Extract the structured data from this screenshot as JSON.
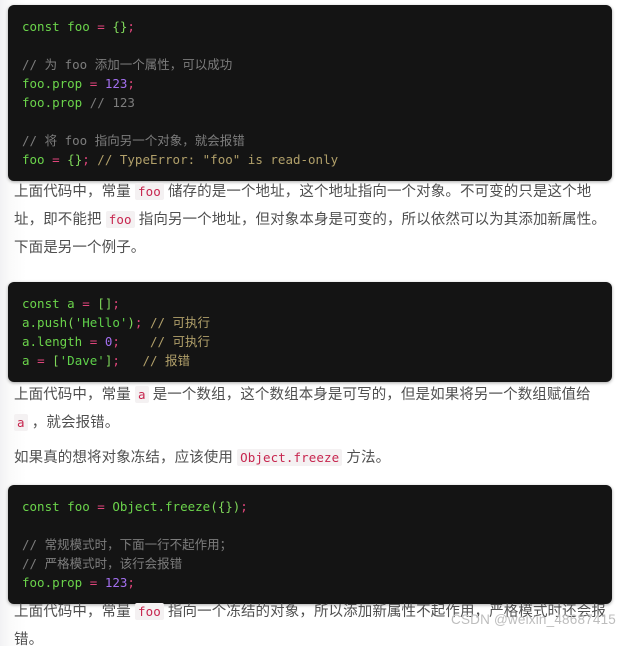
{
  "page": {
    "background_color": "#ffffff",
    "text_color": "#4f4f4f",
    "inline_code_color": "#c7254e",
    "code_block_background": "#141414"
  },
  "code_blocks": [
    {
      "id": "const-foo-object",
      "lines": [
        [
          {
            "text": "const",
            "token": "keyword"
          },
          {
            "text": " ",
            "token": "plain"
          },
          {
            "text": "foo",
            "token": "identifier"
          },
          {
            "text": " ",
            "token": "plain"
          },
          {
            "text": "=",
            "token": "operator"
          },
          {
            "text": " ",
            "token": "plain"
          },
          {
            "text": "{}",
            "token": "punctuation"
          },
          {
            "text": ";",
            "token": "operator"
          }
        ],
        [],
        [
          {
            "text": "// 为 foo 添加一个属性，可以成功",
            "token": "comment"
          }
        ],
        [
          {
            "text": "foo.prop",
            "token": "identifier"
          },
          {
            "text": " ",
            "token": "plain"
          },
          {
            "text": "=",
            "token": "operator"
          },
          {
            "text": " ",
            "token": "plain"
          },
          {
            "text": "123",
            "token": "number"
          },
          {
            "text": ";",
            "token": "operator"
          }
        ],
        [
          {
            "text": "foo.prop",
            "token": "identifier"
          },
          {
            "text": " ",
            "token": "plain"
          },
          {
            "text": "// 123",
            "token": "comment"
          }
        ],
        [],
        [
          {
            "text": "// 将 foo 指向另一个对象，就会报错",
            "token": "comment"
          }
        ],
        [
          {
            "text": "foo",
            "token": "identifier"
          },
          {
            "text": " ",
            "token": "plain"
          },
          {
            "text": "=",
            "token": "operator"
          },
          {
            "text": " ",
            "token": "plain"
          },
          {
            "text": "{}",
            "token": "punctuation"
          },
          {
            "text": ";",
            "token": "operator"
          },
          {
            "text": " ",
            "token": "plain"
          },
          {
            "text": "// TypeError: \"foo\" is read-only",
            "token": "comment-khaki"
          }
        ]
      ]
    },
    {
      "id": "const-a-array",
      "lines": [
        [
          {
            "text": "const",
            "token": "keyword"
          },
          {
            "text": " ",
            "token": "plain"
          },
          {
            "text": "a",
            "token": "identifier"
          },
          {
            "text": " ",
            "token": "plain"
          },
          {
            "text": "=",
            "token": "operator"
          },
          {
            "text": " ",
            "token": "plain"
          },
          {
            "text": "[]",
            "token": "punctuation"
          },
          {
            "text": ";",
            "token": "operator"
          }
        ],
        [
          {
            "text": "a.push",
            "token": "identifier"
          },
          {
            "text": "(",
            "token": "punctuation"
          },
          {
            "text": "'Hello'",
            "token": "string"
          },
          {
            "text": ")",
            "token": "punctuation"
          },
          {
            "text": ";",
            "token": "operator"
          },
          {
            "text": " ",
            "token": "plain"
          },
          {
            "text": "// 可执行",
            "token": "comment-khaki"
          }
        ],
        [
          {
            "text": "a.length",
            "token": "identifier"
          },
          {
            "text": " ",
            "token": "plain"
          },
          {
            "text": "=",
            "token": "operator"
          },
          {
            "text": " ",
            "token": "plain"
          },
          {
            "text": "0",
            "token": "number"
          },
          {
            "text": ";",
            "token": "operator"
          },
          {
            "text": "    ",
            "token": "plain"
          },
          {
            "text": "// 可执行",
            "token": "comment-khaki"
          }
        ],
        [
          {
            "text": "a",
            "token": "identifier"
          },
          {
            "text": " ",
            "token": "plain"
          },
          {
            "text": "=",
            "token": "operator"
          },
          {
            "text": " ",
            "token": "plain"
          },
          {
            "text": "[",
            "token": "punctuation"
          },
          {
            "text": "'Dave'",
            "token": "string"
          },
          {
            "text": "]",
            "token": "punctuation"
          },
          {
            "text": ";",
            "token": "operator"
          },
          {
            "text": "   ",
            "token": "plain"
          },
          {
            "text": "// 报错",
            "token": "comment-khaki"
          }
        ]
      ]
    },
    {
      "id": "object-freeze",
      "lines": [
        [
          {
            "text": "const",
            "token": "keyword"
          },
          {
            "text": " ",
            "token": "plain"
          },
          {
            "text": "foo",
            "token": "identifier"
          },
          {
            "text": " ",
            "token": "plain"
          },
          {
            "text": "=",
            "token": "operator"
          },
          {
            "text": " ",
            "token": "plain"
          },
          {
            "text": "Object.freeze",
            "token": "identifier"
          },
          {
            "text": "({})",
            "token": "punctuation"
          },
          {
            "text": ";",
            "token": "operator"
          }
        ],
        [],
        [
          {
            "text": "// 常规模式时，下面一行不起作用；",
            "token": "comment"
          }
        ],
        [
          {
            "text": "// 严格模式时，该行会报错",
            "token": "comment"
          }
        ],
        [
          {
            "text": "foo.prop",
            "token": "identifier"
          },
          {
            "text": " ",
            "token": "plain"
          },
          {
            "text": "=",
            "token": "operator"
          },
          {
            "text": " ",
            "token": "plain"
          },
          {
            "text": "123",
            "token": "number"
          },
          {
            "text": ";",
            "token": "operator"
          }
        ]
      ]
    }
  ],
  "paragraphs": [
    {
      "id": "para-address",
      "parts": [
        {
          "text": "上面代码中，常量 ",
          "code": false
        },
        {
          "text": "foo",
          "code": true
        },
        {
          "text": " 储存的是一个地址，这个地址指向一个对象。不可变的只是这个地址，即不能把 ",
          "code": false
        },
        {
          "text": "foo",
          "code": true
        },
        {
          "text": " 指向另一个地址，但对象本身是可变的，所以依然可以为其添加新属性。",
          "code": false
        }
      ]
    },
    {
      "id": "para-another-example",
      "parts": [
        {
          "text": "下面是另一个例子。",
          "code": false
        }
      ]
    },
    {
      "id": "para-array-writable",
      "parts": [
        {
          "text": "上面代码中，常量 ",
          "code": false
        },
        {
          "text": "a",
          "code": true
        },
        {
          "text": " 是一个数组，这个数组本身是可写的，但是如果将另一个数组赋值给 ",
          "code": false
        },
        {
          "text": "a",
          "code": true
        },
        {
          "text": " ，就会报错。",
          "code": false
        }
      ]
    },
    {
      "id": "para-freeze-advice",
      "parts": [
        {
          "text": "如果真的想将对象冻结，应该使用 ",
          "code": false
        },
        {
          "text": "Object.freeze",
          "code": true
        },
        {
          "text": " 方法。",
          "code": false
        }
      ]
    },
    {
      "id": "para-frozen-result",
      "parts": [
        {
          "text": "上面代码中，常量 ",
          "code": false
        },
        {
          "text": "foo",
          "code": true
        },
        {
          "text": " 指向一个冻结的对象，所以添加新属性不起作用，严格模式时还会报错。",
          "code": false
        }
      ]
    }
  ],
  "watermark": {
    "text": "CSDN @weixin_48687415"
  }
}
